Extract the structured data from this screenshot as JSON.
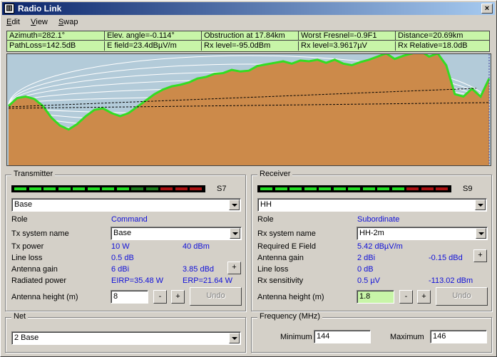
{
  "window": {
    "title": "Radio Link",
    "close_glyph": "×",
    "app_icon": "radio-link-app-icon"
  },
  "menu": [
    {
      "label": "Edit",
      "accel": "E",
      "rest": "dit"
    },
    {
      "label": "View",
      "accel": "V",
      "rest": "iew"
    },
    {
      "label": "Swap",
      "accel": "S",
      "rest": "wap"
    }
  ],
  "info": {
    "azimuth": "Azimuth=282.1°",
    "elev_angle": "Elev. angle=-0.114°",
    "obstruction": "Obstruction at 17.84km",
    "worst_fresnel": "Worst Fresnel=-0.9F1",
    "distance": "Distance=20.69km",
    "path_loss": "PathLoss=142.5dB",
    "e_field": "E field=23.4dBµV/m",
    "rx_level_dbm": "Rx level=-95.0dBm",
    "rx_level_uv": "Rx level=3.9617µV",
    "rx_relative": "Rx Relative=18.0dB"
  },
  "colors": {
    "terrain": "#cc8a4a",
    "terrain_outline": "#33dd22",
    "sky": "#b3cbd9",
    "info_bg": "#c8f5a8",
    "value_text": "#1010d8",
    "meter_green": "#22dd22",
    "meter_dark_green": "#1a7a1a",
    "meter_red": "#aa1111"
  },
  "transmitter": {
    "title": "Transmitter",
    "signal": "S7",
    "meter": [
      "g",
      "g",
      "g",
      "g",
      "g",
      "g",
      "g",
      "g",
      "d",
      "d",
      "r",
      "r",
      "r"
    ],
    "name": "Base",
    "role_label": "Role",
    "role_value": "Command",
    "tx_system_label": "Tx system name",
    "tx_system_value": "Base",
    "tx_power_label": "Tx power",
    "tx_power_w": "10 W",
    "tx_power_dbm": "40 dBm",
    "line_loss_label": "Line loss",
    "line_loss_value": "0.5 dB",
    "antenna_gain_label": "Antenna gain",
    "antenna_gain_dbi": "6 dBi",
    "antenna_gain_dbd": "3.85 dBd",
    "radiated_label": "Radiated power",
    "eirp": "EIRP=35.48 W",
    "erp": "ERP=21.64 W",
    "height_label": "Antenna height (m)",
    "height_value": "8",
    "minus": "-",
    "plus": "+",
    "undo": "Undo"
  },
  "receiver": {
    "title": "Receiver",
    "signal": "S9",
    "meter": [
      "g",
      "g",
      "g",
      "g",
      "g",
      "g",
      "g",
      "g",
      "g",
      "g",
      "r",
      "r",
      "r"
    ],
    "name": "HH",
    "role_label": "Role",
    "role_value": "Subordinate",
    "rx_system_label": "Rx system name",
    "rx_system_value": "HH-2m",
    "req_field_label": "Required E Field",
    "req_field_value": "5.42 dBµV/m",
    "antenna_gain_label": "Antenna gain",
    "antenna_gain_dbi": "2 dBi",
    "antenna_gain_dbd": "-0.15 dBd",
    "line_loss_label": "Line loss",
    "line_loss_value": "0 dB",
    "sensitivity_label": "Rx sensitivity",
    "sensitivity_uv": "0.5 µV",
    "sensitivity_dbm": "-113.02 dBm",
    "height_label": "Antenna height (m)",
    "height_value": "1.8",
    "minus": "-",
    "plus": "+",
    "undo": "Undo"
  },
  "net": {
    "title": "Net",
    "value": "2 Base"
  },
  "frequency": {
    "title": "Frequency (MHz)",
    "min_label": "Minimum",
    "min_value": "144",
    "max_label": "Maximum",
    "max_value": "146"
  },
  "profile": {
    "terrain_elev": [
      3,
      13,
      15,
      12,
      3,
      -12,
      -22,
      -27,
      -20,
      -10,
      -2,
      0,
      -6,
      -10,
      -6,
      2,
      10,
      18,
      24,
      28,
      30,
      33,
      38,
      40,
      44,
      45,
      49,
      47,
      48,
      54,
      56,
      58,
      60,
      57,
      61,
      60,
      62,
      58,
      62,
      57,
      55,
      59,
      62,
      66,
      70,
      63,
      67,
      70,
      73,
      66,
      70,
      55,
      18,
      15,
      25,
      15,
      38
    ],
    "x_labels": [],
    "y_labels": []
  }
}
